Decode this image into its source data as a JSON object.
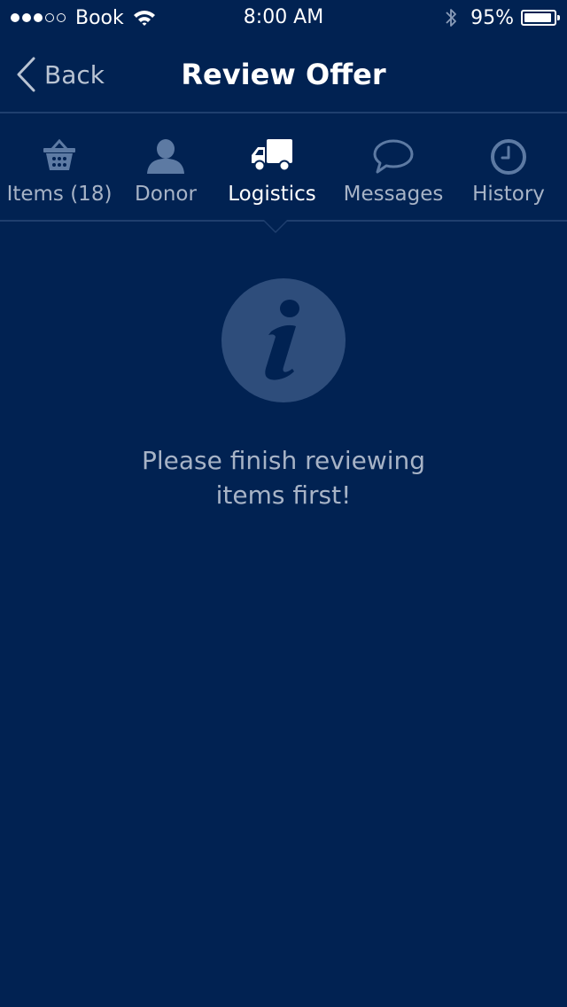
{
  "status_bar": {
    "carrier": "Book",
    "time": "8:00 AM",
    "battery_percent": "95%",
    "battery_level": 0.95,
    "signal_dots_filled": 3,
    "signal_dots_total": 5,
    "icons": [
      "wifi-icon",
      "bluetooth-icon",
      "battery-icon"
    ]
  },
  "nav": {
    "back_label": "Back",
    "title": "Review Offer",
    "back_icon": "chevron-left-icon"
  },
  "tabs": [
    {
      "label": "Items (18)",
      "icon": "basket-icon",
      "active": false
    },
    {
      "label": "Donor",
      "icon": "person-icon",
      "active": false
    },
    {
      "label": "Logistics",
      "icon": "truck-icon",
      "active": true
    },
    {
      "label": "Messages",
      "icon": "speech-bubble-icon",
      "active": false
    },
    {
      "label": "History",
      "icon": "clock-icon",
      "active": false
    }
  ],
  "empty_state": {
    "icon": "info-icon",
    "message_line1": "Please finish reviewing",
    "message_line2": "items first!"
  },
  "colors": {
    "background": "#012252",
    "inactive_tab": "#a7b3c6",
    "icon_muted": "#5d7aa3",
    "info_circle": "#2e4d7b",
    "divider": "#1f3f6e"
  }
}
